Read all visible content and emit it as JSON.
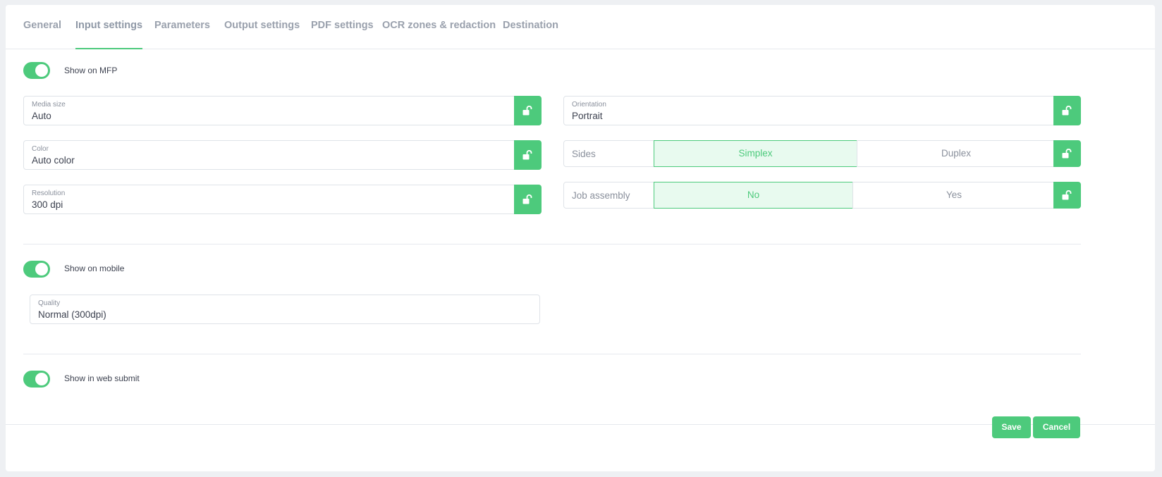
{
  "tabs": [
    {
      "label": "General"
    },
    {
      "label": "Input settings"
    },
    {
      "label": "Parameters"
    },
    {
      "label": "Output settings"
    },
    {
      "label": "PDF settings"
    },
    {
      "label": "OCR zones & redaction"
    },
    {
      "label": "Destination"
    }
  ],
  "active_tab": "Input settings",
  "mfp": {
    "toggle_label": "Show on MFP",
    "toggle_on": true,
    "media_size": {
      "label": "Media size",
      "value": "Auto"
    },
    "orientation": {
      "label": "Orientation",
      "value": "Portrait"
    },
    "color": {
      "label": "Color",
      "value": "Auto color"
    },
    "sides": {
      "label": "Sides",
      "options": [
        "Simplex",
        "Duplex"
      ],
      "selected": "Simplex"
    },
    "resolution": {
      "label": "Resolution",
      "value": "300 dpi"
    },
    "job_assembly": {
      "label": "Job assembly",
      "options": [
        "No",
        "Yes"
      ],
      "selected": "No"
    }
  },
  "mobile": {
    "toggle_label": "Show on mobile",
    "toggle_on": true,
    "quality": {
      "label": "Quality",
      "value": "Normal (300dpi)"
    }
  },
  "web": {
    "toggle_label": "Show in web submit",
    "toggle_on": true
  },
  "footer": {
    "save_label": "Save",
    "cancel_label": "Cancel"
  },
  "colors": {
    "accent": "#4dca7c",
    "accent_light": "#e8faef",
    "tab_text": "#9aa1ad",
    "border": "#dfe3e8"
  },
  "icons": {
    "lock": "unlocked-padlock-icon"
  }
}
